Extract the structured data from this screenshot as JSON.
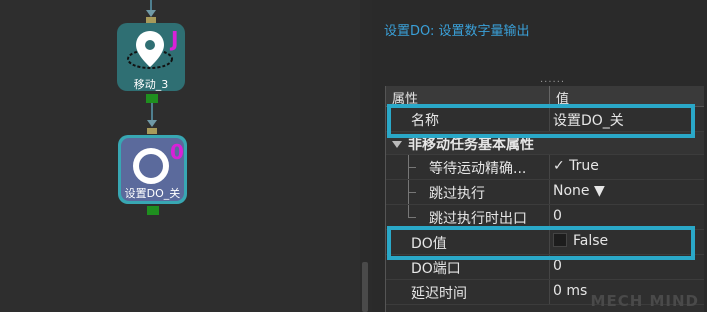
{
  "colors": {
    "accent_title": "#3aa0d8",
    "highlight_box": "#2aa8c8",
    "node_badge": "#d821d8",
    "port_output": "#1f8f1f"
  },
  "canvas": {
    "nodes": [
      {
        "label": "移动_3",
        "badge": "J",
        "icon": "map-pin-icon"
      },
      {
        "label": "设置DO_关",
        "badge": "0",
        "icon": "ring-icon"
      }
    ]
  },
  "panel": {
    "title": "设置DO: 设置数字量输出",
    "splitter": "......",
    "table": {
      "headers": {
        "property": "属性",
        "value": "值"
      },
      "name_row": {
        "label": "名称",
        "value": "设置DO_关"
      },
      "group": {
        "label": "非移动任务基本属性"
      },
      "group_rows": [
        {
          "label": "等待运动精确...",
          "value": "✓ True"
        },
        {
          "label": "跳过执行",
          "value": "None ▼"
        },
        {
          "label": "跳过执行时出口",
          "value": "0"
        }
      ],
      "do_value": {
        "label": "DO值",
        "value": "False"
      },
      "do_port": {
        "label": "DO端口",
        "value": "0"
      },
      "delay": {
        "label": "延迟时间",
        "value": "0 ms"
      }
    }
  },
  "watermark": "MECH MIND"
}
